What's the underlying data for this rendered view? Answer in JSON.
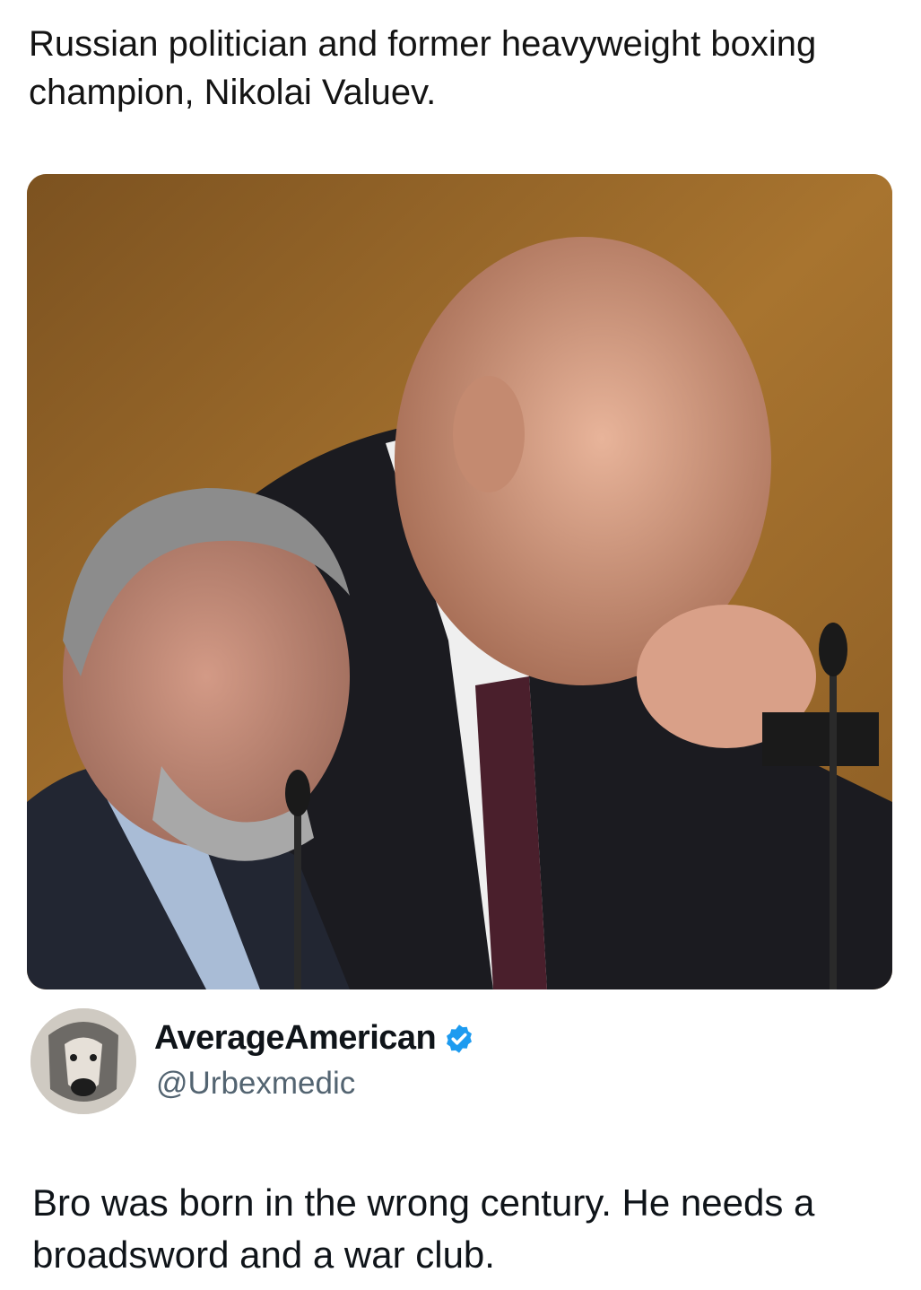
{
  "caption": "Russian politician and former heavyweight boxing champion, Nikolai Valuev.",
  "image": {
    "icon": "photo-two-politicians"
  },
  "author": {
    "display_name": "AverageAmerican",
    "handle": "@Urbexmedic",
    "verified": true,
    "avatar_icon": "dog-avatar"
  },
  "tweet_text": "Bro was born in the wrong century.  He needs a broadsword and a war club.",
  "colors": {
    "verified_badge": "#1d9bf0",
    "handle_gray": "#536471",
    "text": "#0f1419"
  }
}
